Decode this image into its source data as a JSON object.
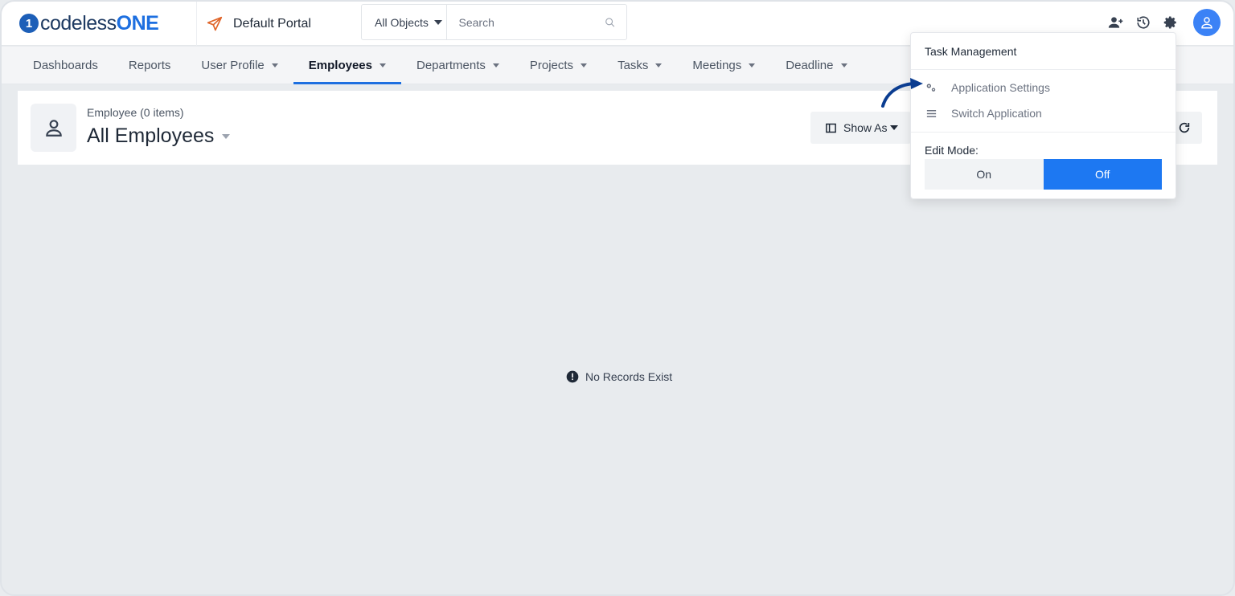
{
  "app": {
    "logo_prefix": "codeless",
    "logo_suffix": "ONE",
    "logo_mark": "1",
    "portal_name": "Default Portal"
  },
  "search": {
    "object_filter": "All Objects",
    "placeholder": "Search"
  },
  "header_icons": [
    "add-user-icon",
    "history-icon",
    "gear-icon",
    "user-avatar-icon"
  ],
  "nav": {
    "items": [
      {
        "label": "Dashboards",
        "dropdown": false
      },
      {
        "label": "Reports",
        "dropdown": false
      },
      {
        "label": "User Profile",
        "dropdown": true
      },
      {
        "label": "Employees",
        "dropdown": true,
        "active": true
      },
      {
        "label": "Departments",
        "dropdown": true
      },
      {
        "label": "Projects",
        "dropdown": true
      },
      {
        "label": "Tasks",
        "dropdown": true
      },
      {
        "label": "Meetings",
        "dropdown": true
      },
      {
        "label": "Deadline",
        "dropdown": true
      }
    ]
  },
  "entity": {
    "subtitle": "Employee (0 items)",
    "title": "All Employees"
  },
  "toolbar": {
    "show_as_label": "Show As"
  },
  "empty_state": {
    "message": "No Records Exist"
  },
  "dropdown": {
    "title": "Task Management",
    "items": [
      {
        "label": "Application Settings",
        "icon": "gears-icon"
      },
      {
        "label": "Switch Application",
        "icon": "menu-lines-icon"
      }
    ],
    "edit_mode_label": "Edit Mode:",
    "toggle": {
      "on_label": "On",
      "off_label": "Off",
      "selected": "Off"
    }
  },
  "colors": {
    "accent": "#1d78f2",
    "brand": "#1d6fe0",
    "portal_icon": "#e0662b",
    "annotation_arrow": "#0b3d91"
  }
}
